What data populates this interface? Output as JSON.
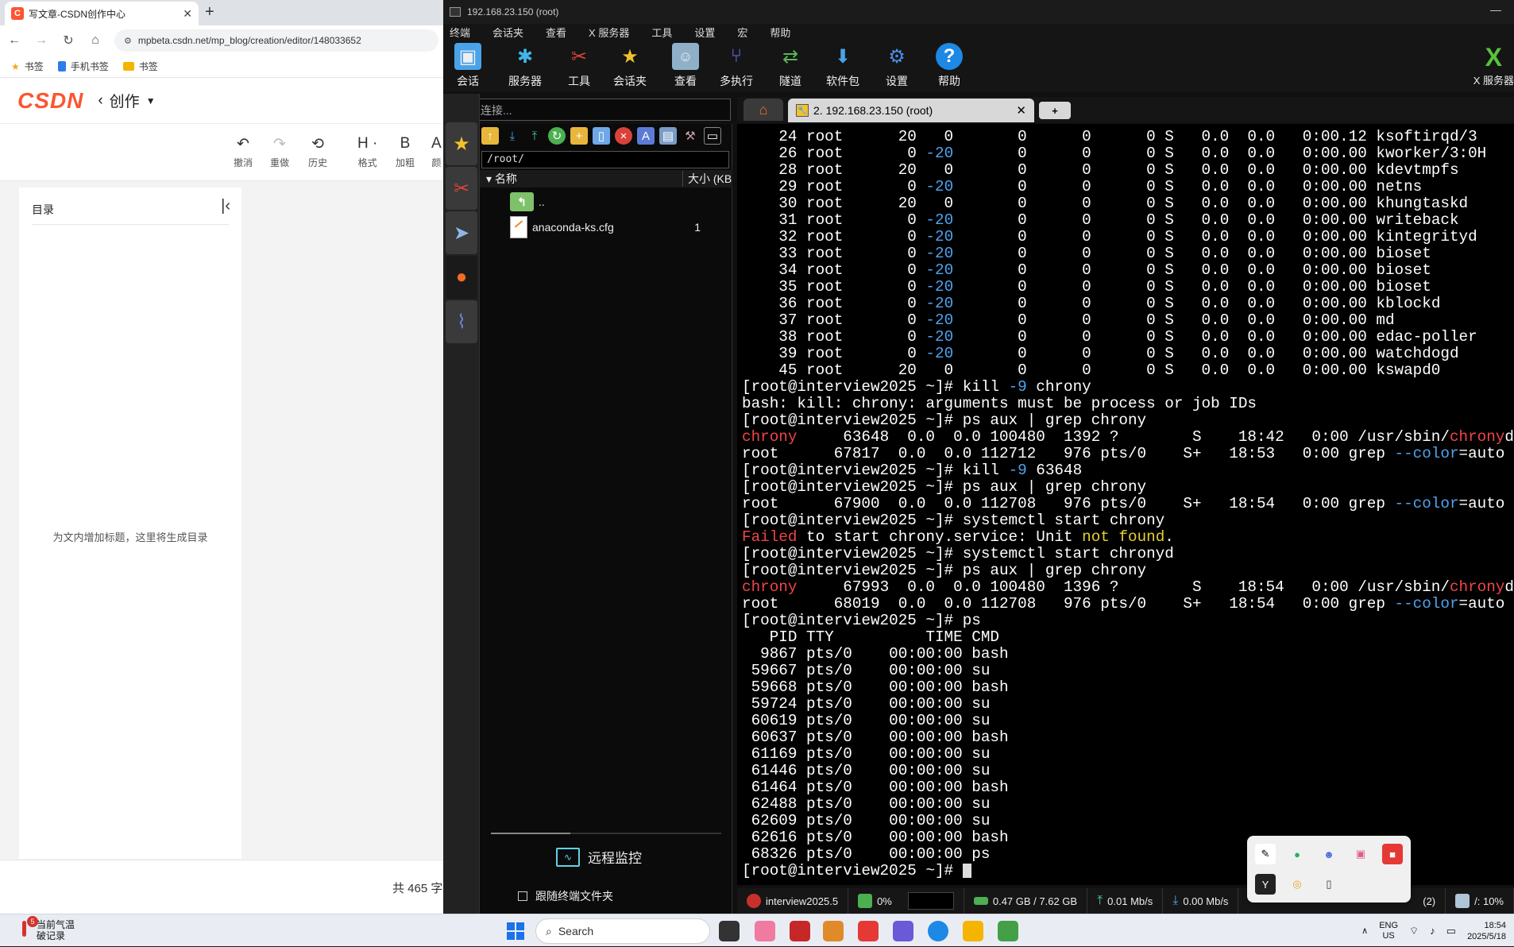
{
  "browser": {
    "tab_title": "写文章-CSDN创作中心",
    "tab_fav": "C",
    "url": "mpbeta.csdn.net/mp_blog/creation/editor/148033652",
    "bookmarks": [
      "书签",
      "手机书签",
      "书签"
    ],
    "logo": "CSDN",
    "create_label": "创作",
    "toolbar": [
      {
        "icon": "↶",
        "label": "撤消"
      },
      {
        "icon": "↷",
        "label": "重做"
      },
      {
        "icon": "⟲",
        "label": "历史"
      },
      {
        "icon": "H ·",
        "label": "格式"
      },
      {
        "icon": "B",
        "label": "加粗"
      },
      {
        "icon": "A",
        "label": "颜"
      }
    ],
    "toc_title": "目录",
    "toc_empty": "为文内增加标题，这里将生成目录",
    "word_count": "共 465 字"
  },
  "moba": {
    "window_title": "192.168.23.150 (root)",
    "menu": [
      "终端",
      "会话夹",
      "查看",
      "X 服务器",
      "工具",
      "设置",
      "宏",
      "帮助"
    ],
    "ribbon": [
      {
        "label": "会话",
        "icon": "session-icon",
        "color": "#4aa3e8"
      },
      {
        "label": "服务器",
        "icon": "servers-icon",
        "color": "#3fb6e8"
      },
      {
        "label": "工具",
        "icon": "tools-icon",
        "color": "#e0443a"
      },
      {
        "label": "会话夹",
        "icon": "star-icon",
        "color": "#f2c12e"
      },
      {
        "label": "查看",
        "icon": "view-icon",
        "color": "#8fb0c8"
      },
      {
        "label": "多执行",
        "icon": "multiexec-icon",
        "color": "#6c6cf0"
      },
      {
        "label": "隧道",
        "icon": "tunnel-icon",
        "color": "#5ab55a"
      },
      {
        "label": "软件包",
        "icon": "packages-icon",
        "color": "#4aa3e8"
      },
      {
        "label": "设置",
        "icon": "settings-icon",
        "color": "#4a8fe8"
      },
      {
        "label": "帮助",
        "icon": "help-icon",
        "color": "#1e88e5"
      }
    ],
    "xserver_label": "X 服务器",
    "quick_connect": "快速连接...",
    "sftp": {
      "path": "/root/",
      "col_name": "名称",
      "col_size": "大小 (KB",
      "files": [
        {
          "name": "..",
          "size": ""
        },
        {
          "name": "anaconda-ks.cfg",
          "size": "1"
        }
      ],
      "remote_monitor": "远程监控",
      "follow_terminal": "跟随终端文件夹"
    },
    "session_tab": "2. 192.168.23.150 (root)",
    "status": {
      "host": "interview2025.5",
      "cpu": "0%",
      "memory": "0.47 GB / 7.62 GB",
      "upload": "0.01 Mb/s",
      "download": "0.00 Mb/s",
      "disk": "/: 10%",
      "extra": "(2)"
    }
  },
  "terminal": [
    [
      [
        "    24 root      20   0       0      0      0 S   0.0  0.0   0:00.12 ksoftirqd/3",
        ""
      ]
    ],
    [
      [
        "    26 root       0 ",
        ""
      ],
      [
        "-20",
        "b"
      ],
      [
        "       0      0      0 S   0.0  0.0   0:00.00 kworker/3:0H",
        ""
      ]
    ],
    [
      [
        "    28 root      20   0       0      0      0 S   0.0  0.0   0:00.00 kdevtmpfs",
        ""
      ]
    ],
    [
      [
        "    29 root       0 ",
        ""
      ],
      [
        "-20",
        "b"
      ],
      [
        "       0      0      0 S   0.0  0.0   0:00.00 netns",
        ""
      ]
    ],
    [
      [
        "    30 root      20   0       0      0      0 S   0.0  0.0   0:00.00 khungtaskd",
        ""
      ]
    ],
    [
      [
        "    31 root       0 ",
        ""
      ],
      [
        "-20",
        "b"
      ],
      [
        "       0      0      0 S   0.0  0.0   0:00.00 writeback",
        ""
      ]
    ],
    [
      [
        "    32 root       0 ",
        ""
      ],
      [
        "-20",
        "b"
      ],
      [
        "       0      0      0 S   0.0  0.0   0:00.00 kintegrityd",
        ""
      ]
    ],
    [
      [
        "    33 root       0 ",
        ""
      ],
      [
        "-20",
        "b"
      ],
      [
        "       0      0      0 S   0.0  0.0   0:00.00 bioset",
        ""
      ]
    ],
    [
      [
        "    34 root       0 ",
        ""
      ],
      [
        "-20",
        "b"
      ],
      [
        "       0      0      0 S   0.0  0.0   0:00.00 bioset",
        ""
      ]
    ],
    [
      [
        "    35 root       0 ",
        ""
      ],
      [
        "-20",
        "b"
      ],
      [
        "       0      0      0 S   0.0  0.0   0:00.00 bioset",
        ""
      ]
    ],
    [
      [
        "    36 root       0 ",
        ""
      ],
      [
        "-20",
        "b"
      ],
      [
        "       0      0      0 S   0.0  0.0   0:00.00 kblockd",
        ""
      ]
    ],
    [
      [
        "    37 root       0 ",
        ""
      ],
      [
        "-20",
        "b"
      ],
      [
        "       0      0      0 S   0.0  0.0   0:00.00 md",
        ""
      ]
    ],
    [
      [
        "    38 root       0 ",
        ""
      ],
      [
        "-20",
        "b"
      ],
      [
        "       0      0      0 S   0.0  0.0   0:00.00 edac-poller",
        ""
      ]
    ],
    [
      [
        "    39 root       0 ",
        ""
      ],
      [
        "-20",
        "b"
      ],
      [
        "       0      0      0 S   0.0  0.0   0:00.00 watchdogd",
        ""
      ]
    ],
    [
      [
        "    45 root      20   0       0      0      0 S   0.0  0.0   0:00.00 kswapd0",
        ""
      ]
    ],
    [
      [
        "[root@interview2025 ~]# kill ",
        ""
      ],
      [
        "-9",
        "b"
      ],
      [
        " chrony",
        ""
      ]
    ],
    [
      [
        "bash: kill: chrony: arguments must be process or job IDs",
        ""
      ]
    ],
    [
      [
        "[root@interview2025 ~]# ps aux | grep chrony",
        ""
      ]
    ],
    [
      [
        "chrony",
        "r"
      ],
      [
        "     63648  0.0  0.0 100480  1392 ?        S    18:42   0:00 /usr/sbin/",
        ""
      ],
      [
        "chrony",
        "r"
      ],
      [
        "d",
        ""
      ]
    ],
    [
      [
        "root      67817  0.0  0.0 112712   976 pts/0    S+   18:53   0:00 grep ",
        ""
      ],
      [
        "--color",
        "b"
      ],
      [
        "=auto ",
        ""
      ],
      [
        "chrony",
        "r"
      ]
    ],
    [
      [
        "[root@interview2025 ~]# kill ",
        ""
      ],
      [
        "-9",
        "b"
      ],
      [
        " 63648",
        ""
      ]
    ],
    [
      [
        "[root@interview2025 ~]# ps aux | grep chrony",
        ""
      ]
    ],
    [
      [
        "root      67900  0.0  0.0 112708   976 pts/0    S+   18:54   0:00 grep ",
        ""
      ],
      [
        "--color",
        "b"
      ],
      [
        "=auto ",
        ""
      ],
      [
        "chrony",
        "r"
      ]
    ],
    [
      [
        "[root@interview2025 ~]# systemctl start chrony",
        ""
      ]
    ],
    [
      [
        "Failed",
        "r"
      ],
      [
        " to start chrony.service: Unit ",
        ""
      ],
      [
        "not found",
        "y"
      ],
      [
        ".",
        ""
      ]
    ],
    [
      [
        "[root@interview2025 ~]# systemctl start chronyd",
        ""
      ]
    ],
    [
      [
        "[root@interview2025 ~]# ps aux | grep chrony",
        ""
      ]
    ],
    [
      [
        "chrony",
        "r"
      ],
      [
        "     67993  0.0  0.0 100480  1396 ?        S    18:54   0:00 /usr/sbin/",
        ""
      ],
      [
        "chrony",
        "r"
      ],
      [
        "d",
        ""
      ]
    ],
    [
      [
        "root      68019  0.0  0.0 112708   976 pts/0    S+   18:54   0:00 grep ",
        ""
      ],
      [
        "--color",
        "b"
      ],
      [
        "=auto ",
        ""
      ],
      [
        "chrony",
        "r"
      ]
    ],
    [
      [
        "[root@interview2025 ~]# ps",
        ""
      ]
    ],
    [
      [
        "   PID TTY          TIME CMD",
        ""
      ]
    ],
    [
      [
        "  9867 pts/0    00:00:00 bash",
        ""
      ]
    ],
    [
      [
        " 59667 pts/0    00:00:00 su",
        ""
      ]
    ],
    [
      [
        " 59668 pts/0    00:00:00 bash",
        ""
      ]
    ],
    [
      [
        " 59724 pts/0    00:00:00 su",
        ""
      ]
    ],
    [
      [
        " 60619 pts/0    00:00:00 su",
        ""
      ]
    ],
    [
      [
        " 60637 pts/0    00:00:00 bash",
        ""
      ]
    ],
    [
      [
        " 61169 pts/0    00:00:00 su",
        ""
      ]
    ],
    [
      [
        " 61446 pts/0    00:00:00 su",
        ""
      ]
    ],
    [
      [
        " 61464 pts/0    00:00:00 bash",
        ""
      ]
    ],
    [
      [
        " 62488 pts/0    00:00:00 su",
        ""
      ]
    ],
    [
      [
        " 62609 pts/0    00:00:00 su",
        ""
      ]
    ],
    [
      [
        " 62616 pts/0    00:00:00 bash",
        ""
      ]
    ],
    [
      [
        " 68326 pts/0    00:00:00 ps",
        ""
      ]
    ],
    [
      [
        "[root@interview2025 ~]# ",
        ""
      ]
    ]
  ],
  "taskbar": {
    "weather_title": "当前气温",
    "weather_sub": "破记录",
    "weather_badge": "5",
    "search_placeholder": "Search",
    "lang_top": "ENG",
    "lang_bottom": "US",
    "time": "18:54",
    "date": "2025/5/18"
  }
}
